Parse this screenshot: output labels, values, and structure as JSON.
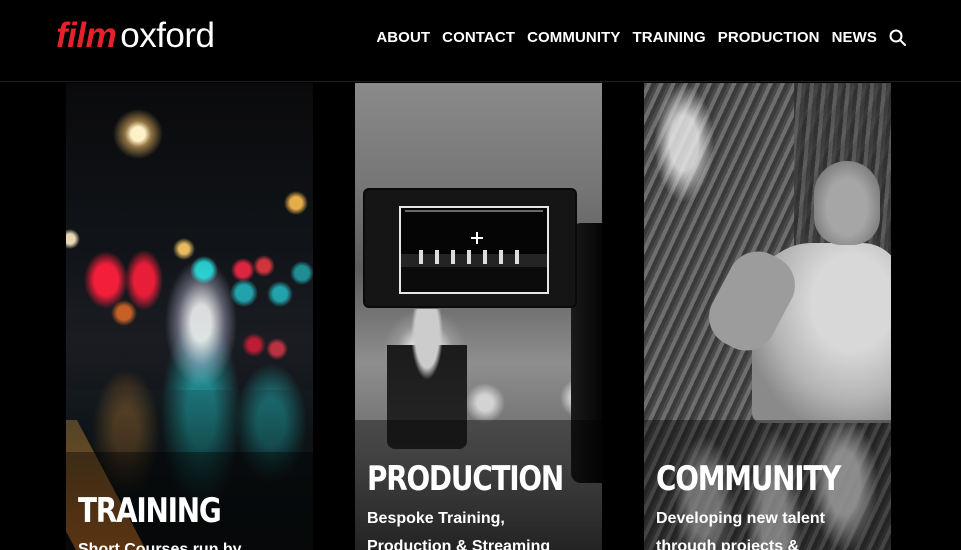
{
  "header": {
    "logo": {
      "film": "film",
      "oxford": "oxford"
    },
    "nav": [
      "ABOUT",
      "CONTACT",
      "COMMUNITY",
      "TRAINING",
      "PRODUCTION",
      "NEWS"
    ],
    "search_icon": "search-icon"
  },
  "cards": [
    {
      "title": "TRAINING",
      "description": "Short Courses run by",
      "image": "night-street-bokeh"
    },
    {
      "title": "PRODUCTION",
      "description": "Bespoke Training, Production & Streaming",
      "image": "camera-viewfinder-stage"
    },
    {
      "title": "COMMUNITY",
      "description": "Developing new talent through projects &",
      "image": "performer-by-tree"
    }
  ],
  "colors": {
    "background": "#000000",
    "logo_red": "#e8202a",
    "text": "#ffffff"
  }
}
